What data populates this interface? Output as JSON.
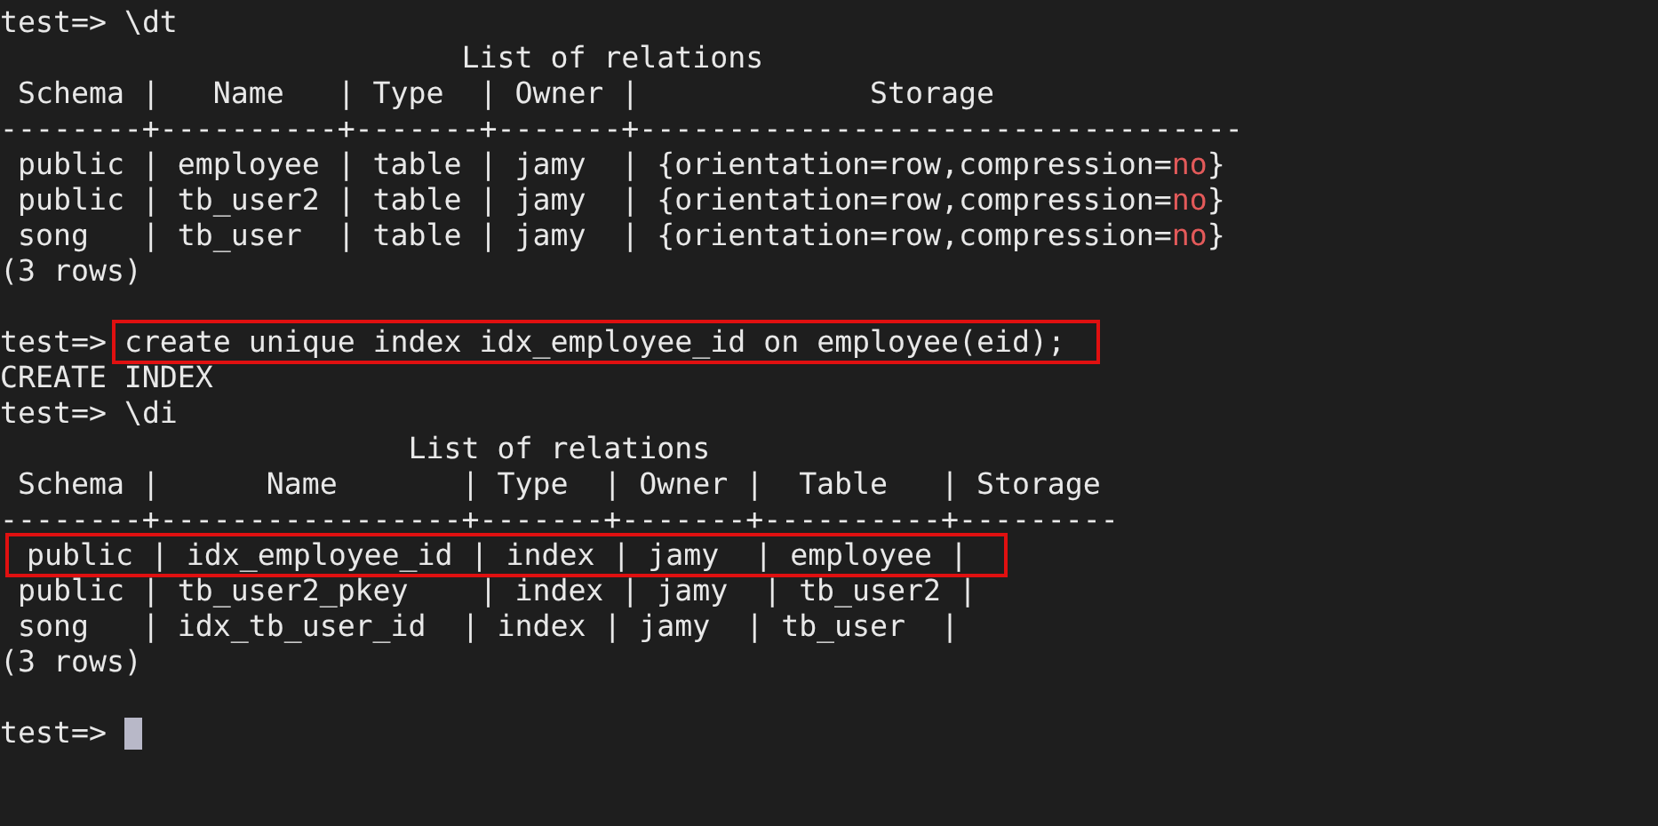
{
  "lines": [
    {
      "kind": "prompt",
      "prompt": "test=>",
      "command": "\\dt"
    },
    {
      "kind": "title",
      "text": "                          List of relations"
    },
    {
      "kind": "header",
      "text": " Schema |   Name   | Type  | Owner |             Storage"
    },
    {
      "kind": "separator",
      "text": "--------+----------+-------+-------+----------------------------------"
    },
    {
      "kind": "row",
      "segments": [
        {
          "kind": "plain",
          "text": " public | employee | table | jamy  | {orientation=row,compression="
        },
        {
          "kind": "keyword",
          "text": "no"
        },
        {
          "kind": "plain",
          "text": "}"
        }
      ]
    },
    {
      "kind": "row",
      "segments": [
        {
          "kind": "plain",
          "text": " public | tb_user2 | table | jamy  | {orientation=row,compression="
        },
        {
          "kind": "keyword",
          "text": "no"
        },
        {
          "kind": "plain",
          "text": "}"
        }
      ]
    },
    {
      "kind": "row",
      "segments": [
        {
          "kind": "plain",
          "text": " song   | tb_user  | table | jamy  | {orientation=row,compression="
        },
        {
          "kind": "keyword",
          "text": "no"
        },
        {
          "kind": "plain",
          "text": "}"
        }
      ]
    },
    {
      "kind": "output",
      "text": "(3 rows)"
    },
    {
      "kind": "blank"
    },
    {
      "kind": "prompt",
      "prompt": "test=>",
      "command": "create unique index idx_employee_id on employee(eid);",
      "highlighted": true
    },
    {
      "kind": "output",
      "text": "CREATE INDEX"
    },
    {
      "kind": "prompt",
      "prompt": "test=>",
      "command": "\\di"
    },
    {
      "kind": "title",
      "text": "                       List of relations"
    },
    {
      "kind": "header",
      "text": " Schema |      Name       | Type  | Owner |  Table   | Storage"
    },
    {
      "kind": "separator",
      "text": "--------+-----------------+-------+-------+----------+---------"
    },
    {
      "kind": "row",
      "highlighted": true,
      "segments": [
        {
          "kind": "plain",
          "text": " public | idx_employee_id | index | jamy  | employee |"
        }
      ]
    },
    {
      "kind": "row",
      "segments": [
        {
          "kind": "plain",
          "text": " public | tb_user2_pkey    | index | jamy  | tb_user2 |"
        }
      ]
    },
    {
      "kind": "row",
      "segments": [
        {
          "kind": "plain",
          "text": " song   | idx_tb_user_id  | index | jamy  | tb_user  |"
        }
      ]
    },
    {
      "kind": "output",
      "text": "(3 rows)"
    },
    {
      "kind": "blank"
    },
    {
      "kind": "prompt",
      "prompt": "test=>",
      "cursor": true
    }
  ]
}
